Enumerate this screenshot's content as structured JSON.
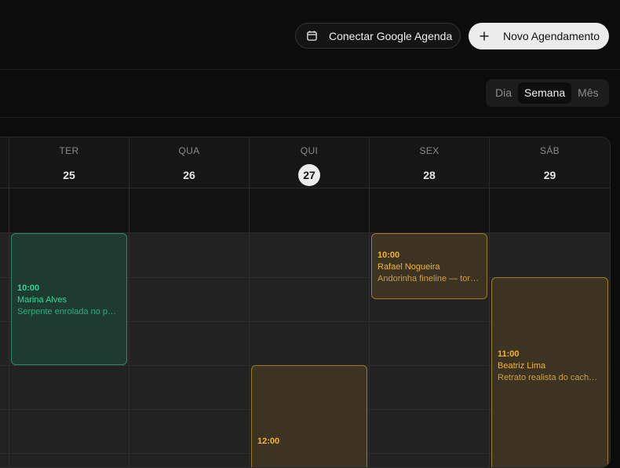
{
  "header": {
    "google_button": "Conectar Google Agenda",
    "new_button": "Novo Agendamento"
  },
  "view_toggle": {
    "options": [
      "Dia",
      "Semana",
      "Mês"
    ],
    "selected": "Semana"
  },
  "days": [
    {
      "name": "TER",
      "num": "25",
      "today": false
    },
    {
      "name": "QUA",
      "num": "26",
      "today": false
    },
    {
      "name": "QUI",
      "num": "27",
      "today": true
    },
    {
      "name": "SEX",
      "num": "28",
      "today": false
    },
    {
      "name": "SÁB",
      "num": "29",
      "today": false
    }
  ],
  "events": [
    {
      "day": "TER",
      "time": "10:00",
      "name": "Marina Alves",
      "desc": "Serpente enrolada no punho",
      "color": "green"
    },
    {
      "day": "SEX",
      "time": "10:00",
      "name": "Rafael Nogueira",
      "desc": "Andorinha fineline — tornozelo",
      "color": "amber"
    },
    {
      "day": "SÁB",
      "time": "11:00",
      "name": "Beatriz Lima",
      "desc": "Retrato realista do cachorro",
      "color": "amber"
    },
    {
      "day": "QUI",
      "time": "12:00",
      "name": "",
      "desc": "",
      "color": "amber"
    }
  ]
}
